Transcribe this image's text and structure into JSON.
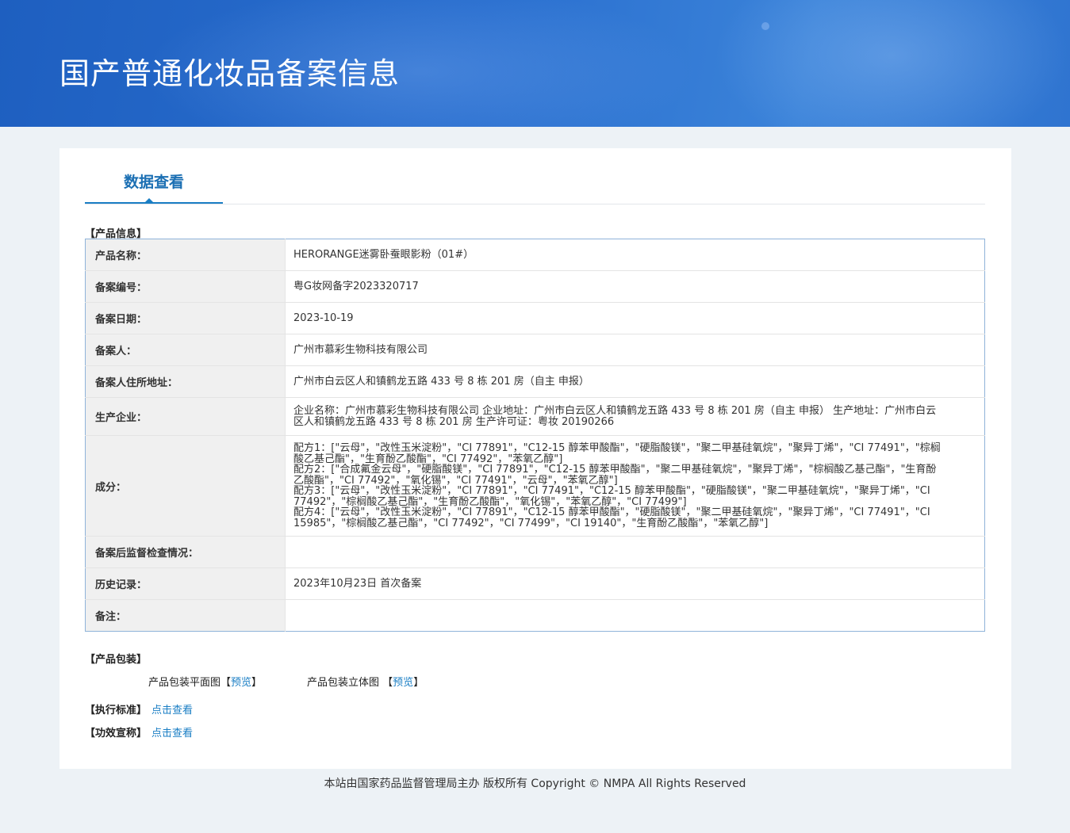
{
  "header": {
    "title": "国产普通化妆品备案信息"
  },
  "tabs": [
    {
      "label": "数据查看"
    }
  ],
  "sections": {
    "product_info": "【产品信息】",
    "packaging": "【产品包装】",
    "standard": "【执行标准】",
    "efficacy": "【功效宣称】"
  },
  "rows": [
    {
      "key": "产品名称：",
      "value": "HERORANGE迷雾卧蚕眼影粉（01#）"
    },
    {
      "key": "备案编号：",
      "value": "粤G妆网备字2023320717"
    },
    {
      "key": "备案日期：",
      "value": "2023-10-19"
    },
    {
      "key": "备案人：",
      "value": "广州市慕彩生物科技有限公司"
    },
    {
      "key": "备案人住所地址：",
      "value": "广州市白云区人和镇鹤龙五路 433 号 8 栋 201 房（自主 申报）"
    },
    {
      "key": "生产企业：",
      "value": "企业名称：广州市慕彩生物科技有限公司 企业地址：广州市白云区人和镇鹤龙五路 433 号 8 栋 201 房（自主 申报） 生产地址：广州市白云区人和镇鹤龙五路 433 号 8 栋 201 房 生产许可证：粤妆 20190266"
    },
    {
      "key": "成分：",
      "lines": [
        "配方1：[\"云母\"，\"改性玉米淀粉\"，\"CI 77891\"，\"C12-15 醇苯甲酸酯\"，\"硬脂酸镁\"，\"聚二甲基硅氧烷\"，\"聚异丁烯\"，\"CI 77491\"，\"棕榈酸乙基己酯\"，\"生育酚乙酸酯\"，\"CI 77492\"，\"苯氧乙醇\"]",
        "配方2：[\"合成氟金云母\"，\"硬脂酸镁\"，\"CI 77891\"，\"C12-15 醇苯甲酸酯\"，\"聚二甲基硅氧烷\"，\"聚异丁烯\"，\"棕榈酸乙基己酯\"，\"生育酚乙酸酯\"，\"CI 77492\"，\"氧化锡\"，\"CI 77491\"，\"云母\"，\"苯氧乙醇\"]",
        "配方3：[\"云母\"，\"改性玉米淀粉\"，\"CI 77891\"，\"CI 77491\"，\"C12-15 醇苯甲酸酯\"，\"硬脂酸镁\"，\"聚二甲基硅氧烷\"，\"聚异丁烯\"，\"CI 77492\"，\"棕榈酸乙基己酯\"，\"生育酚乙酸酯\"，\"氧化锡\"，\"苯氧乙醇\"，\"CI 77499\"]",
        "配方4：[\"云母\"，\"改性玉米淀粉\"，\"CI 77891\"，\"C12-15 醇苯甲酸酯\"，\"硬脂酸镁\"，\"聚二甲基硅氧烷\"，\"聚异丁烯\"，\"CI 77491\"，\"CI 15985\"，\"棕榈酸乙基己酯\"，\"CI 77492\"，\"CI 77499\"，\"CI 19140\"，\"生育酚乙酸酯\"，\"苯氧乙醇\"]"
      ]
    },
    {
      "key": "备案后监督检查情况：",
      "value": ""
    },
    {
      "key": "历史记录：",
      "value": "2023年10月23日 首次备案"
    },
    {
      "key": "备注：",
      "value": ""
    }
  ],
  "packaging": {
    "flat_label": "产品包装平面图",
    "solid_label": "产品包装立体图",
    "bracket_open": "【",
    "bracket_close": "】",
    "preview": "预览"
  },
  "links": {
    "view": "点击查看"
  },
  "footer": "本站由国家药品监督管理局主办 版权所有 Copyright © NMPA All Rights Reserved"
}
